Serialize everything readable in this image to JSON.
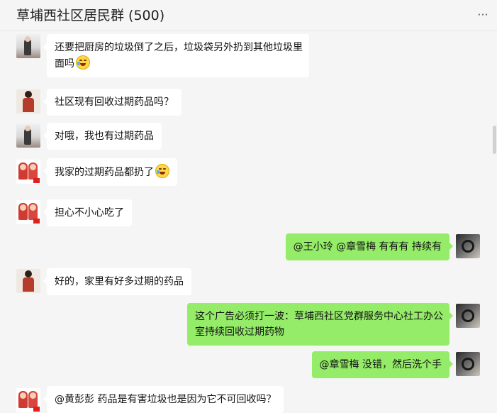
{
  "header": {
    "title": "草埔西社区居民群 (500)",
    "more_label": "···"
  },
  "messages": [
    {
      "side": "left",
      "avatar": "avatar-a",
      "lines": [
        "还要把厨房的垃圾倒了之后，垃圾袋另外扔到其他垃圾里",
        "面吗"
      ],
      "emoji": "laughing-tears-emoji"
    },
    {
      "side": "left",
      "avatar": "avatar-b",
      "text": "社区现有回收过期药品吗？"
    },
    {
      "side": "left",
      "avatar": "avatar-a",
      "text": "对哦，我也有过期药品"
    },
    {
      "side": "left",
      "avatar": "avatar-c",
      "text": "我家的过期药品都扔了",
      "emoji": "crying-emoji"
    },
    {
      "side": "left",
      "avatar": "avatar-c",
      "text": "担心不小心吃了"
    },
    {
      "side": "right",
      "avatar": "avatar-d",
      "text": "@王小玲 @章雪梅 有有有   持续有"
    },
    {
      "side": "left",
      "avatar": "avatar-b",
      "text": "好的，家里有好多过期的药品"
    },
    {
      "side": "right",
      "avatar": "avatar-d",
      "lines": [
        "这个广告必须打一波：草埔西社区党群服务中心社工办公",
        "室持续回收过期药物"
      ]
    },
    {
      "side": "right",
      "avatar": "avatar-d",
      "text": "@章雪梅 没错，然后洗个手"
    },
    {
      "side": "left",
      "avatar": "avatar-c",
      "text": "@黄彭彭 药品是有害垃圾也是因为它不可回收吗？"
    }
  ]
}
